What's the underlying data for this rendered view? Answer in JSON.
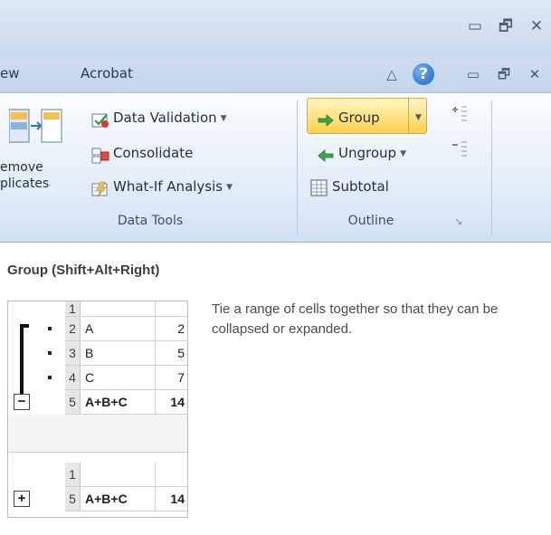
{
  "window": {
    "minimize_glyph": "▭",
    "restore_glyph": "🗗",
    "close_glyph": "✕"
  },
  "tabs": {
    "view_partial": "ew",
    "acrobat": "Acrobat",
    "caret_glyph": "△",
    "help_glyph": "?"
  },
  "ribbon": {
    "data_tools": {
      "label": "Data Tools",
      "remove_duplicates_line1": "emove",
      "remove_duplicates_line2": "plicates",
      "data_validation": "Data Validation",
      "consolidate": "Consolidate",
      "what_if": "What-If Analysis"
    },
    "outline": {
      "label": "Outline",
      "group": "Group",
      "ungroup": "Ungroup",
      "subtotal": "Subtotal"
    },
    "dropdown_glyph": "▼",
    "launcher_glyph": "↘"
  },
  "tooltip": {
    "title": "Group (Shift+Alt+Right)",
    "description": "Tie a range of cells together so that they can be collapsed or expanded.",
    "expanded_rows": [
      {
        "num": "1",
        "a": "",
        "b": ""
      },
      {
        "num": "2",
        "a": "A",
        "b": "2"
      },
      {
        "num": "3",
        "a": "B",
        "b": "5"
      },
      {
        "num": "4",
        "a": "C",
        "b": "7"
      },
      {
        "num": "5",
        "a": "A+B+C",
        "b": "14"
      }
    ],
    "collapsed_rows": [
      {
        "num": "1",
        "a": "",
        "b": ""
      },
      {
        "num": "5",
        "a": "A+B+C",
        "b": "14"
      }
    ],
    "minus_glyph": "−",
    "plus_glyph": "+"
  }
}
